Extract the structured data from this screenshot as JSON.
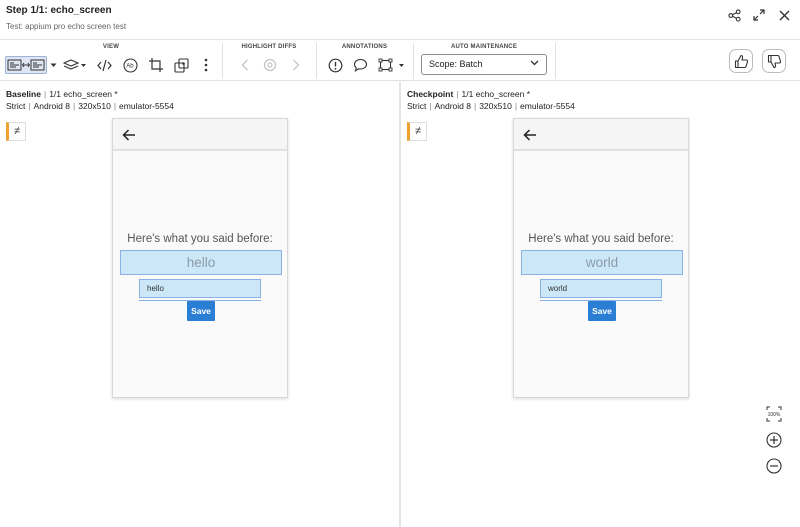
{
  "header": {
    "title": "Step 1/1:  echo_screen",
    "subtitle": "Test: appium pro echo screen test"
  },
  "toolbar": {
    "view_label": "VIEW",
    "highlight_label": "HIGHLIGHT DIFFS",
    "annotations_label": "ANNOTATIONS",
    "maintenance_label": "AUTO MAINTENANCE",
    "scope_value": "Scope: Batch"
  },
  "baseline": {
    "name": "Baseline",
    "step": "1/1 echo_screen *",
    "match_level": "Strict",
    "os": "Android 8",
    "viewport": "320x510",
    "device": "emulator-5554",
    "neq": "≠",
    "screen": {
      "prompt": "Here's what you said before:",
      "echo": "hello",
      "input_value": "hello",
      "save_label": "Save"
    }
  },
  "checkpoint": {
    "name": "Checkpoint",
    "step": "1/1 echo_screen *",
    "match_level": "Strict",
    "os": "Android 8",
    "viewport": "320x510",
    "device": "emulator-5554",
    "neq": "≠",
    "screen": {
      "prompt": "Here's what you said before:",
      "echo": "world",
      "input_value": "world",
      "save_label": "Save"
    }
  },
  "zoom": {
    "fit_label": "100%"
  },
  "colors": {
    "accent": "#2a7fd4",
    "diff_marker": "#f0a030",
    "highlight": "#cce7f8"
  }
}
